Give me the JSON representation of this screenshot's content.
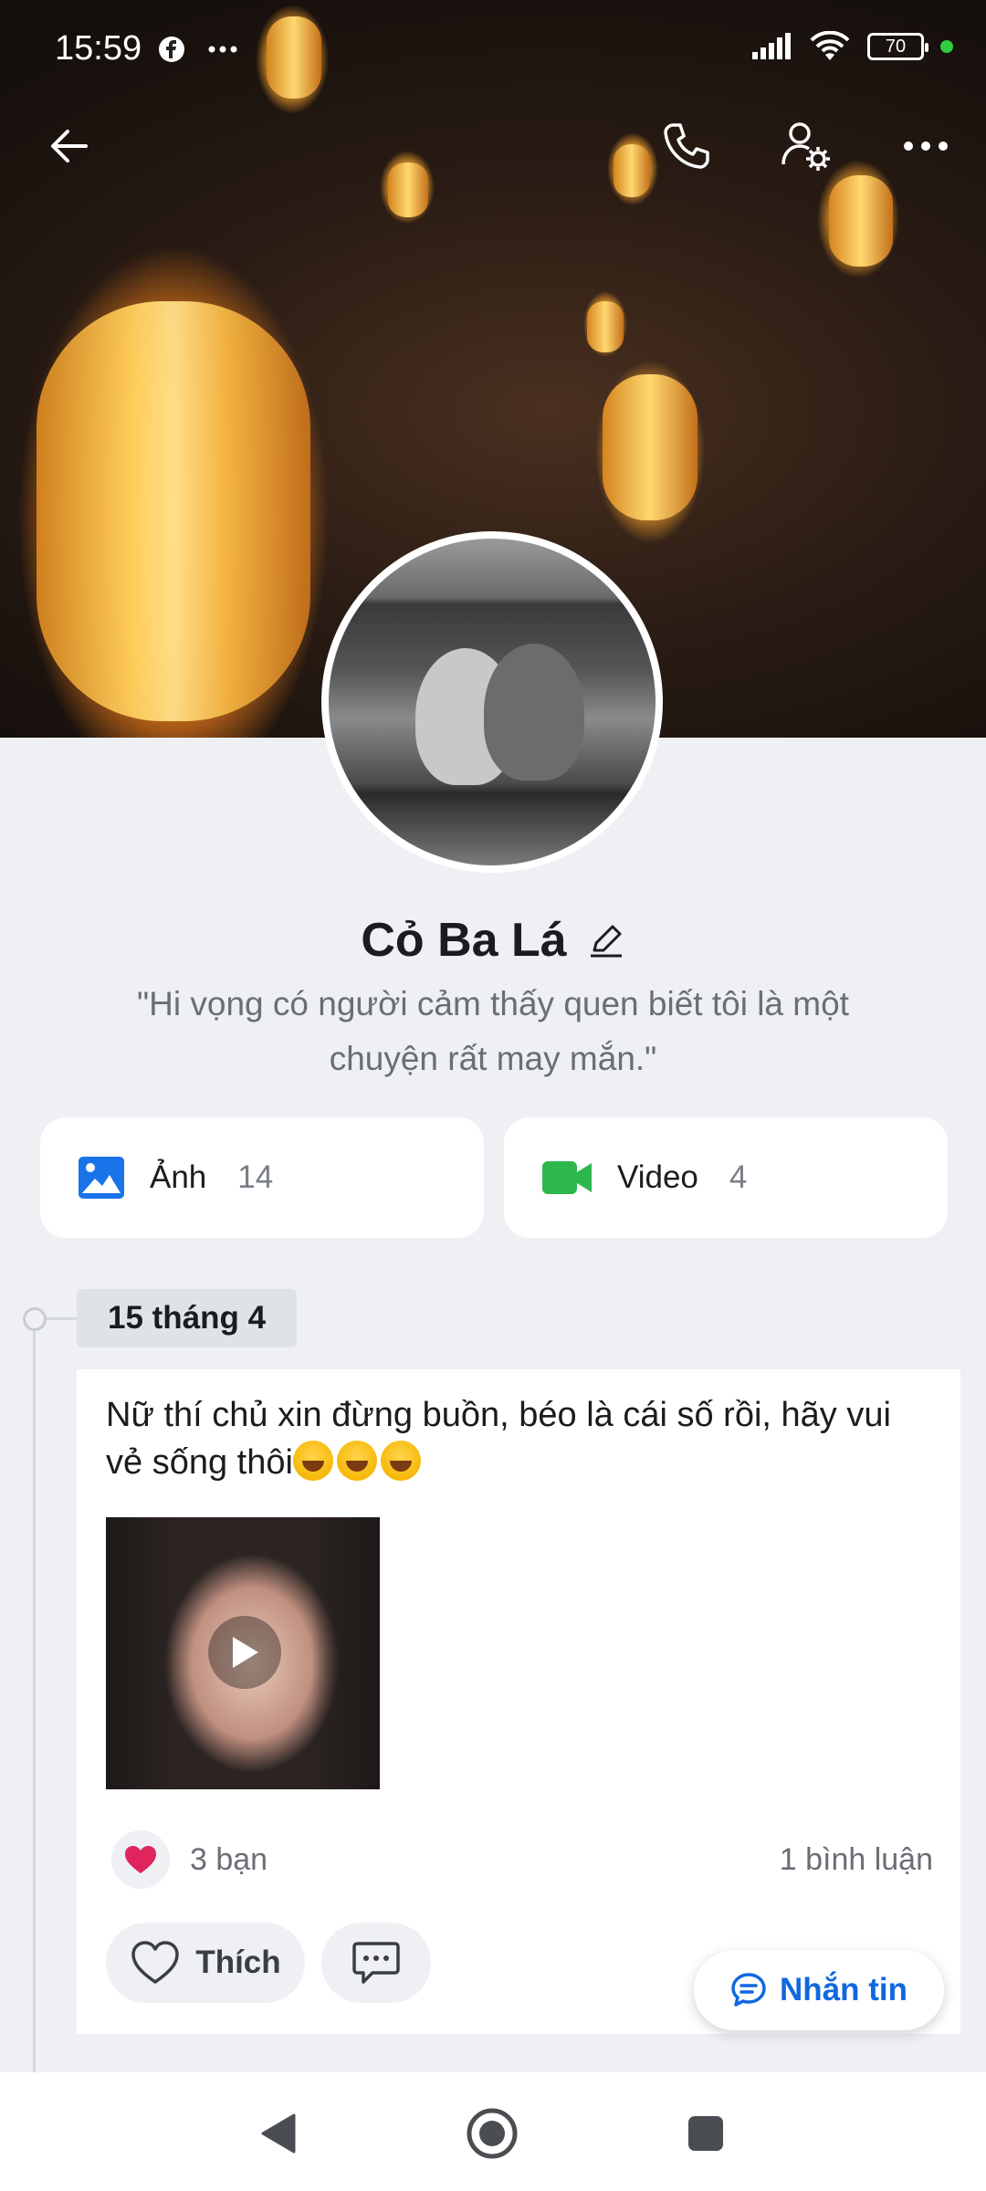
{
  "status_bar": {
    "time": "15:59",
    "left_icons": [
      "facebook-icon",
      "more-dots-icon"
    ],
    "battery": "70"
  },
  "top_bar": {
    "icons": [
      "back-arrow-icon",
      "phone-icon",
      "profile-settings-icon",
      "more-icon"
    ]
  },
  "profile": {
    "name": "Cỏ Ba Lá",
    "bio": "\"Hi vọng có người cảm thấy quen biết tôi là một chuyện rất may mắn.\""
  },
  "media": [
    {
      "label": "Ảnh",
      "count": "14",
      "icon": "photo-icon",
      "color": "#1a73e8"
    },
    {
      "label": "Video",
      "count": "4",
      "icon": "video-camera-icon",
      "color": "#2db84d"
    }
  ],
  "timeline": {
    "date": "15 tháng 4"
  },
  "post": {
    "text": "Nữ thí chủ xin đừng buồn, béo là cái số rồi, hãy vui vẻ sống thôi",
    "emoji_count": 3,
    "reactions": "3 bạn",
    "comments": "1 bình luận",
    "like_label": "Thích"
  },
  "fab": {
    "label": "Nhắn tin"
  },
  "colors": {
    "accent": "#1068e0",
    "heart": "#e0245e"
  }
}
